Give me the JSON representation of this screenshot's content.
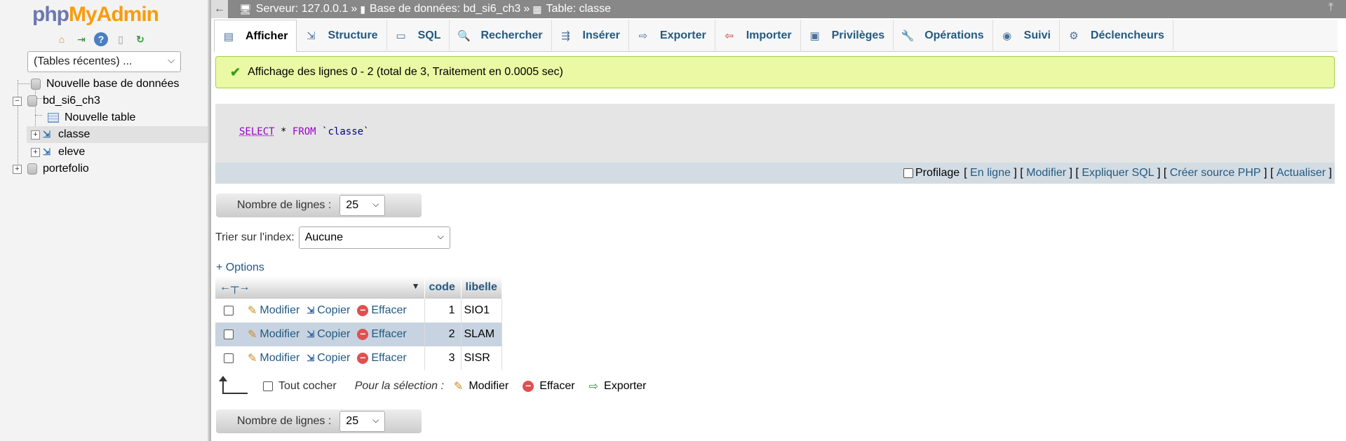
{
  "app": {
    "logo_part1": "php",
    "logo_part2": "MyAdmin"
  },
  "sidebar": {
    "recent_select": "(Tables récentes) ...",
    "tree": {
      "new_db": "Nouvelle base de données",
      "db1": "bd_si6_ch3",
      "new_table": "Nouvelle table",
      "table1": "classe",
      "table2": "eleve",
      "db2": "portefolio"
    }
  },
  "breadcrumb": {
    "server": "Serveur: 127.0.0.1",
    "sep1": "»",
    "database": "Base de données: bd_si6_ch3",
    "sep2": "»",
    "table": "Table: classe"
  },
  "tabs": [
    "Afficher",
    "Structure",
    "SQL",
    "Rechercher",
    "Insérer",
    "Exporter",
    "Importer",
    "Privilèges",
    "Opérations",
    "Suivi",
    "Déclencheurs"
  ],
  "success_message": "Affichage des lignes 0 - 2 (total de 3, Traitement en 0.0005 sec)",
  "sql": {
    "kw_select": "SELECT",
    "star": "*",
    "kw_from": "FROM",
    "table": "`classe`"
  },
  "sql_options": {
    "profiling": "Profilage",
    "open": "[",
    "close": "]",
    "links": [
      "En ligne",
      "Modifier",
      "Expliquer SQL",
      "Créer source PHP",
      "Actualiser"
    ]
  },
  "row_count": {
    "label": "Nombre de lignes :",
    "value": "25"
  },
  "sort": {
    "label": "Trier sur l'index:",
    "value": "Aucune"
  },
  "options_link": "+ Options",
  "table": {
    "headers": [
      "code",
      "libelle"
    ],
    "action_labels": {
      "edit": "Modifier",
      "copy": "Copier",
      "delete": "Effacer"
    },
    "rows": [
      {
        "code": "1",
        "libelle": "SIO1"
      },
      {
        "code": "2",
        "libelle": "SLAM"
      },
      {
        "code": "3",
        "libelle": "SISR"
      }
    ]
  },
  "bulk": {
    "check_all": "Tout cocher",
    "with_selected": "Pour la sélection :",
    "edit": "Modifier",
    "delete": "Effacer",
    "export": "Exporter"
  },
  "colors": {
    "accent": "#235a81",
    "success_bg": "#ebf8a4",
    "selected_row": "#c7d3e0"
  }
}
